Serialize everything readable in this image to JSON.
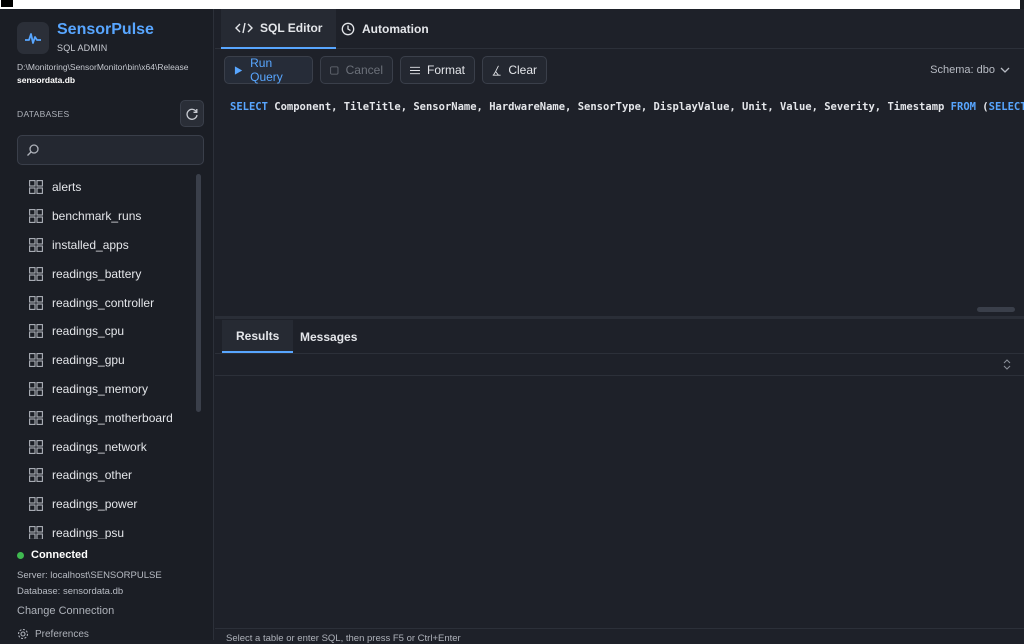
{
  "app": {
    "name": "SensorPulse",
    "subtitle": "SQL ADMIN",
    "db_path": "D:\\Monitoring\\SensorMonitor\\bin\\x64\\Release",
    "db_file": "sensordata.db"
  },
  "sidebar": {
    "databases_header": "DATABASES",
    "search_placeholder": "",
    "tables": [
      "alerts",
      "benchmark_runs",
      "installed_apps",
      "readings_battery",
      "readings_controller",
      "readings_cpu",
      "readings_gpu",
      "readings_memory",
      "readings_motherboard",
      "readings_network",
      "readings_other",
      "readings_power",
      "readings_psu"
    ],
    "status": "Connected",
    "server": "Server: localhost\\SENSORPULSE",
    "database": "Database: sensordata.db",
    "change_connection": "Change Connection",
    "preferences": "Preferences"
  },
  "tabs": {
    "sql_editor": "SQL Editor",
    "automation": "Automation"
  },
  "toolbar": {
    "run": "Run Query",
    "cancel": "Cancel",
    "format": "Format",
    "clear": "Clear",
    "schema": "Schema: dbo"
  },
  "editor": {
    "kw_select": "SELECT",
    "columns": " Component, TileTitle, SensorName, HardwareName, SensorType, DisplayValue, Unit, Value, Severity, Timestamp ",
    "kw_from": "FROM",
    "tail_paren": " (",
    "kw_select2": "SELECT"
  },
  "results": {
    "tab_results": "Results",
    "tab_messages": "Messages",
    "hint": "Select a table or enter SQL, then press F5 or Ctrl+Enter"
  },
  "colors": {
    "accent": "#58a6ff",
    "connected": "#3fb950",
    "background": "#1e2129"
  }
}
